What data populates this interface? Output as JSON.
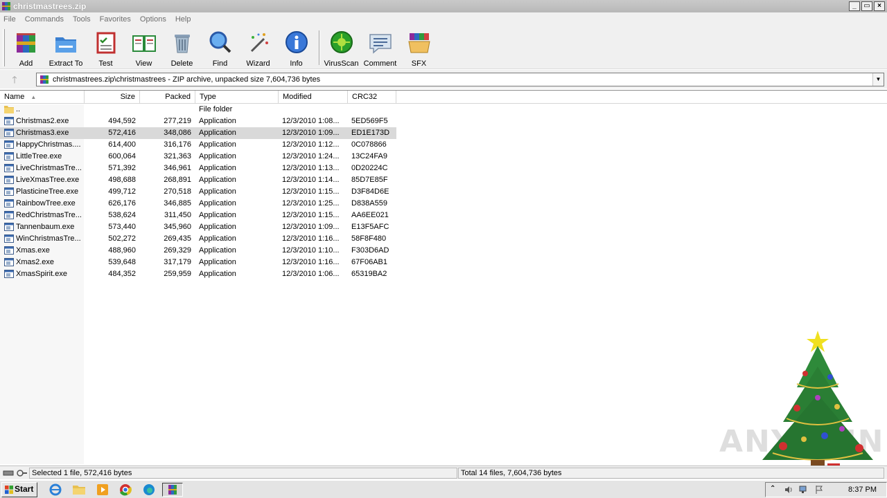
{
  "window": {
    "title": "christmastrees.zip",
    "controls": [
      "_",
      "▭",
      "×"
    ]
  },
  "menu": [
    "File",
    "Commands",
    "Tools",
    "Favorites",
    "Options",
    "Help"
  ],
  "toolbar": {
    "add": "Add",
    "extract": "Extract To",
    "test": "Test",
    "view": "View",
    "delete": "Delete",
    "find": "Find",
    "wizard": "Wizard",
    "info": "Info",
    "virusscan": "VirusScan",
    "comment": "Comment",
    "sfx": "SFX"
  },
  "address": {
    "path": "christmastrees.zip\\christmastrees - ZIP archive, unpacked size 7,604,736 bytes"
  },
  "columns": {
    "name": "Name",
    "size": "Size",
    "packed": "Packed",
    "type": "Type",
    "modified": "Modified",
    "crc": "CRC32"
  },
  "parent_row": {
    "name": "..",
    "type": "File folder"
  },
  "files": [
    {
      "name": "Christmas2.exe",
      "size": "494,592",
      "packed": "277,219",
      "type": "Application",
      "modified": "12/3/2010 1:08...",
      "crc": "5ED569F5"
    },
    {
      "name": "Christmas3.exe",
      "size": "572,416",
      "packed": "348,086",
      "type": "Application",
      "modified": "12/3/2010 1:09...",
      "crc": "ED1E173D"
    },
    {
      "name": "HappyChristmas....",
      "size": "614,400",
      "packed": "316,176",
      "type": "Application",
      "modified": "12/3/2010 1:12...",
      "crc": "0C078866"
    },
    {
      "name": "LittleTree.exe",
      "size": "600,064",
      "packed": "321,363",
      "type": "Application",
      "modified": "12/3/2010 1:24...",
      "crc": "13C24FA9"
    },
    {
      "name": "LiveChristmasTre...",
      "size": "571,392",
      "packed": "346,961",
      "type": "Application",
      "modified": "12/3/2010 1:13...",
      "crc": "0D20224C"
    },
    {
      "name": "LiveXmasTree.exe",
      "size": "498,688",
      "packed": "268,891",
      "type": "Application",
      "modified": "12/3/2010 1:14...",
      "crc": "85D7E85F"
    },
    {
      "name": "PlasticineTree.exe",
      "size": "499,712",
      "packed": "270,518",
      "type": "Application",
      "modified": "12/3/2010 1:15...",
      "crc": "D3F84D6E"
    },
    {
      "name": "RainbowTree.exe",
      "size": "626,176",
      "packed": "346,885",
      "type": "Application",
      "modified": "12/3/2010 1:25...",
      "crc": "D838A559"
    },
    {
      "name": "RedChristmasTre...",
      "size": "538,624",
      "packed": "311,450",
      "type": "Application",
      "modified": "12/3/2010 1:15...",
      "crc": "AA6EE021"
    },
    {
      "name": "Tannenbaum.exe",
      "size": "573,440",
      "packed": "345,960",
      "type": "Application",
      "modified": "12/3/2010 1:09...",
      "crc": "E13F5AFC"
    },
    {
      "name": "WinChristmasTre...",
      "size": "502,272",
      "packed": "269,435",
      "type": "Application",
      "modified": "12/3/2010 1:16...",
      "crc": "58F8F480"
    },
    {
      "name": "Xmas.exe",
      "size": "488,960",
      "packed": "269,329",
      "type": "Application",
      "modified": "12/3/2010 1:10...",
      "crc": "F303D6AD"
    },
    {
      "name": "Xmas2.exe",
      "size": "539,648",
      "packed": "317,179",
      "type": "Application",
      "modified": "12/3/2010 1:16...",
      "crc": "67F06AB1"
    },
    {
      "name": "XmasSpirit.exe",
      "size": "484,352",
      "packed": "259,959",
      "type": "Application",
      "modified": "12/3/2010 1:06...",
      "crc": "65319BA2"
    }
  ],
  "selected_index": 1,
  "status": {
    "left": "Selected 1 file, 572,416 bytes",
    "right": "Total 14 files, 7,604,736 bytes"
  },
  "taskbar": {
    "start": "Start",
    "clock": "8:37 PM"
  },
  "watermark": "ANY RUN",
  "colors": {
    "selected_row": "#d9d9d9",
    "title_bar": "#c0c0c0"
  }
}
